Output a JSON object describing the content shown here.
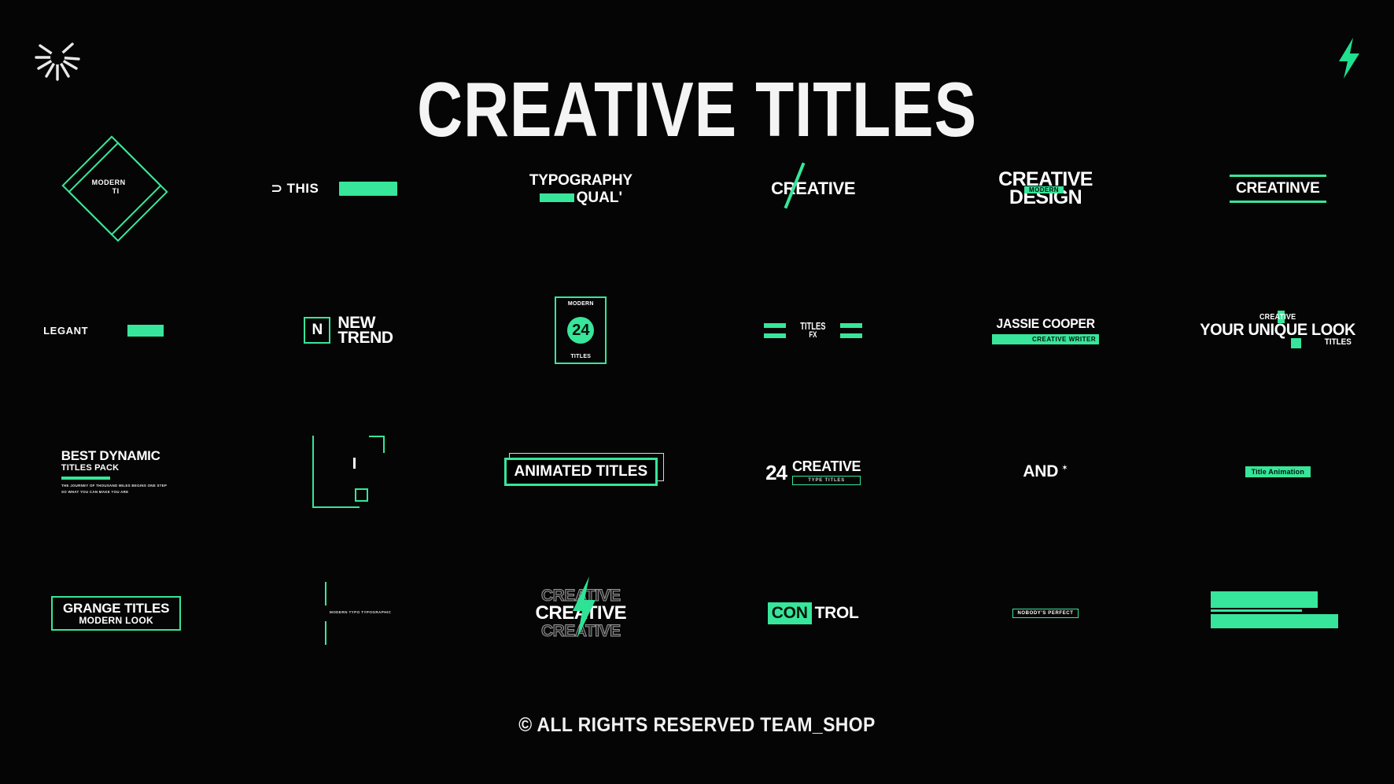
{
  "page": {
    "background_color": "#050505",
    "accent_color": "#37e69a",
    "text_color": "#ffffff"
  },
  "header": {
    "title": "CREATIVE TITLES",
    "left_icon": "burst-icon",
    "right_icon": "lightning-bolt-icon"
  },
  "items": {
    "diamond": {
      "line1": "MODERN",
      "line2": "TI"
    },
    "this_bar": {
      "text": "⊃ THIS"
    },
    "typography": {
      "line1": "TYPOGRAPHY",
      "line2": "QUAL'"
    },
    "creative_slash": {
      "text": "CREATIVE"
    },
    "creative_design": {
      "line1": "CREATIVE",
      "line2": "DESIGN",
      "badge": "MODERN"
    },
    "creatinve": {
      "text": "CREATINVE"
    },
    "legant": {
      "text": "LEGANT"
    },
    "new_trend": {
      "mark": "N",
      "line1": "NEW",
      "line2": "TREND"
    },
    "card24": {
      "top": "MODERN",
      "number": "24",
      "bottom": "TITLES"
    },
    "titles_fx": {
      "line1": "TITLES",
      "line2": "FX"
    },
    "jassie": {
      "name": "JASSIE COOPER",
      "role": "CREATIVE WRITER"
    },
    "unique_look": {
      "small_top": "CREATIVE",
      "main": "YOUR UNIQUE LOOK",
      "small_bottom": "TITLES"
    },
    "best_dynamic": {
      "line1": "BEST DYNAMIC",
      "line2": "TITLES PACK",
      "sub1": "THE JOURNEY OF THOUSAND MILES BEGINS ONE STEP",
      "sub2": "SO WHAT YOU CAN MAKE YOU ARE"
    },
    "bracket": {
      "label": ""
    },
    "animated_titles": {
      "text": "ANIMATED TITLES"
    },
    "twentyfour_creative": {
      "number": "24",
      "big": "CREATIVE",
      "tag": "TYPE TITLES"
    },
    "and": {
      "text": "AND",
      "star": "✶"
    },
    "title_animation": {
      "text": "Title Animation"
    },
    "grange": {
      "line1": "GRANGE TITLES",
      "line2": "MODERN LOOK"
    },
    "thin_lines": {
      "caption": "MODERN TYPO TYPOGRAPHIC"
    },
    "creative_bolt": {
      "ghost_top": "CREATIVE",
      "main": "CREATIVE",
      "ghost_bottom": "CREATIVE"
    },
    "control": {
      "part_a": "CON",
      "part_b": "TROL"
    },
    "nobodys_perfect": {
      "text": "NOBODY'S PERFECT"
    },
    "stacked_bars": {
      "label": ""
    }
  },
  "footer": {
    "text": "© ALL RIGHTS RESERVED TEAM_SHOP"
  }
}
